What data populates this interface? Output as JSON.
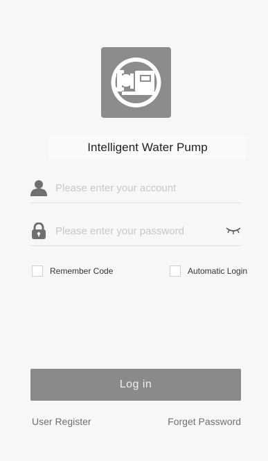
{
  "app": {
    "title": "Intelligent Water Pump",
    "logo_icon": "water-pump-icon"
  },
  "login_form": {
    "account": {
      "placeholder": "Please enter your account",
      "value": "",
      "icon": "user-icon"
    },
    "password": {
      "placeholder": "Please enter your password",
      "value": "",
      "icon": "lock-icon",
      "visibility_icon": "eye-closed-icon"
    },
    "remember_code": {
      "label": "Remember Code",
      "checked": false
    },
    "automatic_login": {
      "label": "Automatic Login",
      "checked": false
    },
    "login_button": "Log in"
  },
  "links": {
    "register": "User Register",
    "forget_password": "Forget Password"
  },
  "colors": {
    "background": "#f7f7f7",
    "button": "#8a8a8a",
    "logo_background": "#8c8c8c",
    "icon": "#6f6f6f",
    "placeholder": "#c8c8c8"
  }
}
